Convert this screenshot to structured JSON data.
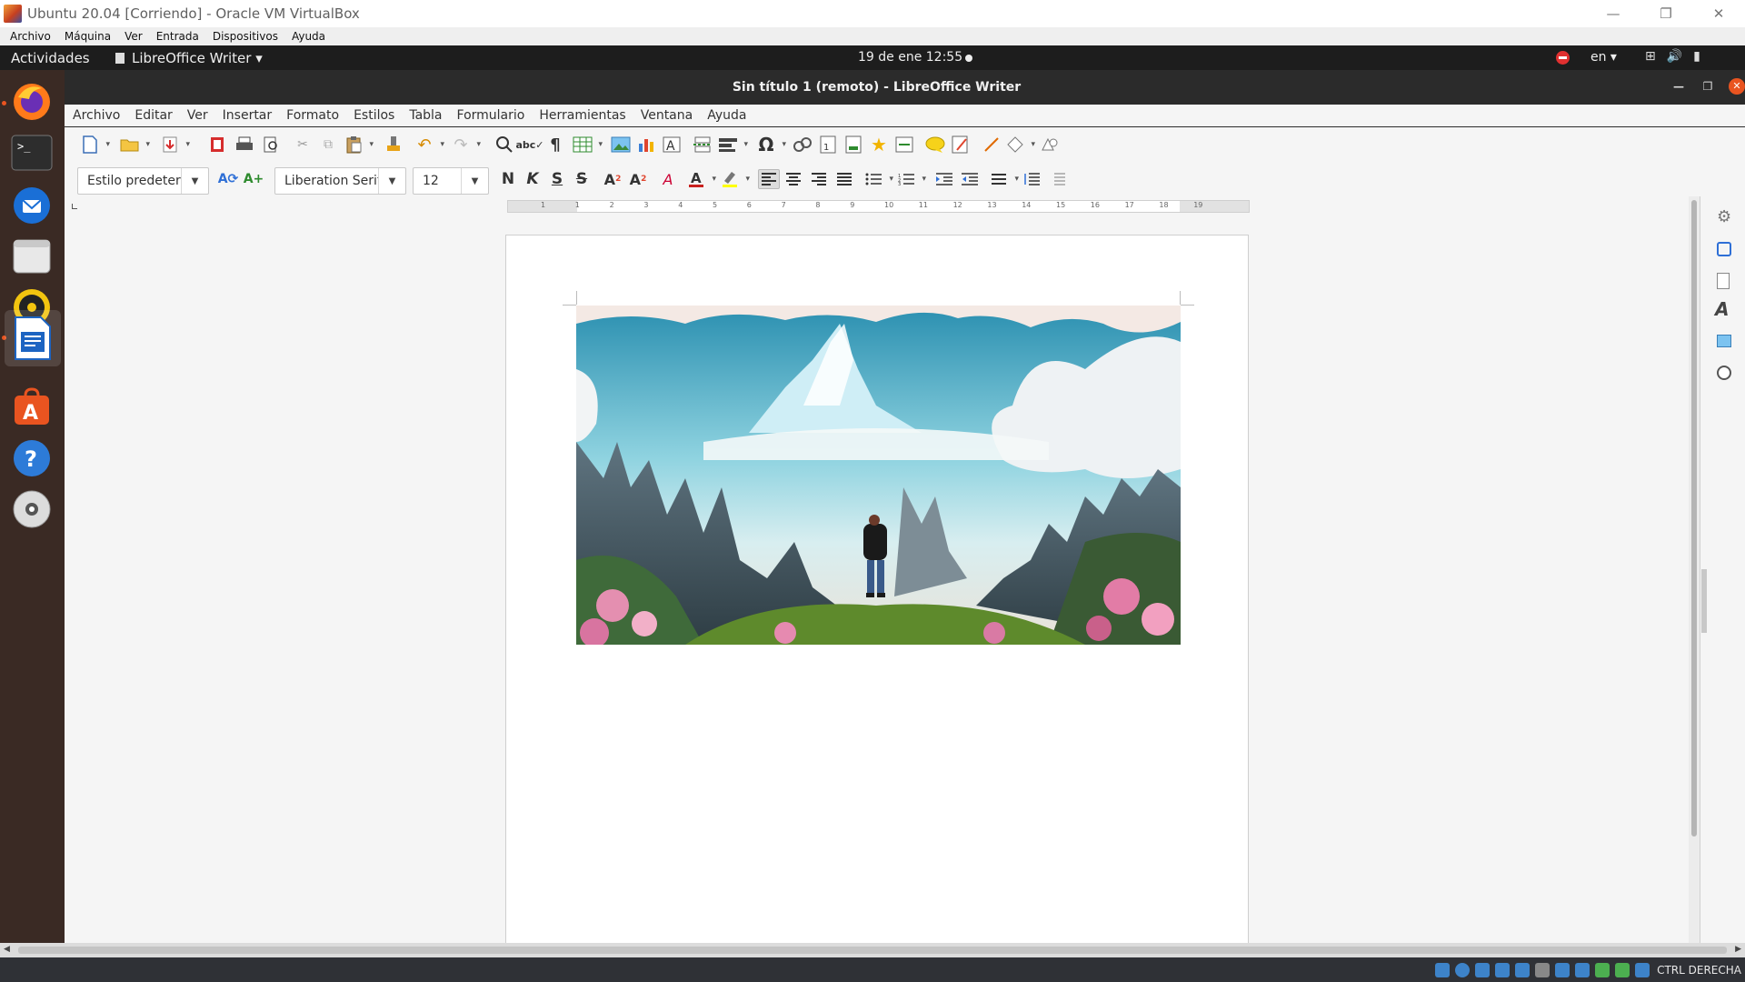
{
  "vbox": {
    "title": "Ubuntu 20.04 [Corriendo] - Oracle VM VirtualBox",
    "menu": [
      "Archivo",
      "Máquina",
      "Ver",
      "Entrada",
      "Dispositivos",
      "Ayuda"
    ],
    "host_key": "CTRL DERECHA"
  },
  "ubuntu": {
    "activities": "Actividades",
    "app_menu": "LibreOffice Writer ▾",
    "clock": "19 de ene  12:55",
    "language": "en ▾"
  },
  "dock": [
    "firefox-icon",
    "terminal-icon",
    "thunderbird-icon",
    "files-icon",
    "rhythmbox-icon",
    "writer-icon",
    "software-icon",
    "help-icon",
    "dvd-icon"
  ],
  "writer": {
    "title": "Sin título 1 (remoto) - LibreOffice Writer",
    "menu": [
      "Archivo",
      "Editar",
      "Ver",
      "Insertar",
      "Formato",
      "Estilos",
      "Tabla",
      "Formulario",
      "Herramientas",
      "Ventana",
      "Ayuda"
    ],
    "paragraph_style": "Estilo predeterminado",
    "font_name": "Liberation Serif",
    "font_size": "12",
    "ruler_numbers": [
      "1",
      "1",
      "2",
      "3",
      "4",
      "5",
      "6",
      "7",
      "8",
      "9",
      "10",
      "11",
      "12",
      "13",
      "14",
      "15",
      "16",
      "17",
      "18",
      "19"
    ]
  },
  "colors": {
    "ubuntu_orange": "#e95420",
    "font_color": "#c9211e",
    "highlight_color": "#ffff00"
  }
}
